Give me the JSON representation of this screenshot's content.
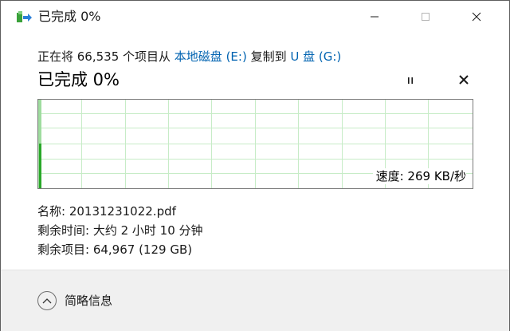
{
  "window": {
    "title": "已完成 0%"
  },
  "copy": {
    "prefix": "正在将 66,535 个项目从 ",
    "source": "本地磁盘 (E:)",
    "middle": " 复制到 ",
    "destination": "U 盘 (G:)"
  },
  "status": {
    "title": "已完成 0%",
    "speed": "速度: 269 KB/秒",
    "pause_icon": "pause-icon",
    "cancel_icon": "close-icon"
  },
  "progress": {
    "percent_complete": 0
  },
  "details": {
    "name": "名称: 20131231022.pdf",
    "time_remaining": "剩余时间: 大约 2 小时 10 分钟",
    "items_remaining": "剩余项目: 64,967 (129 GB)"
  },
  "footer": {
    "toggle_label": "简略信息",
    "toggle_icon": "chevron-up-icon"
  },
  "colors": {
    "graph_grid": "#c7ecc7",
    "graph_fill": "#9fdc9f",
    "graph_bar": "#29a829",
    "link": "#0063b1",
    "footer_bg": "#f0f0f0"
  }
}
